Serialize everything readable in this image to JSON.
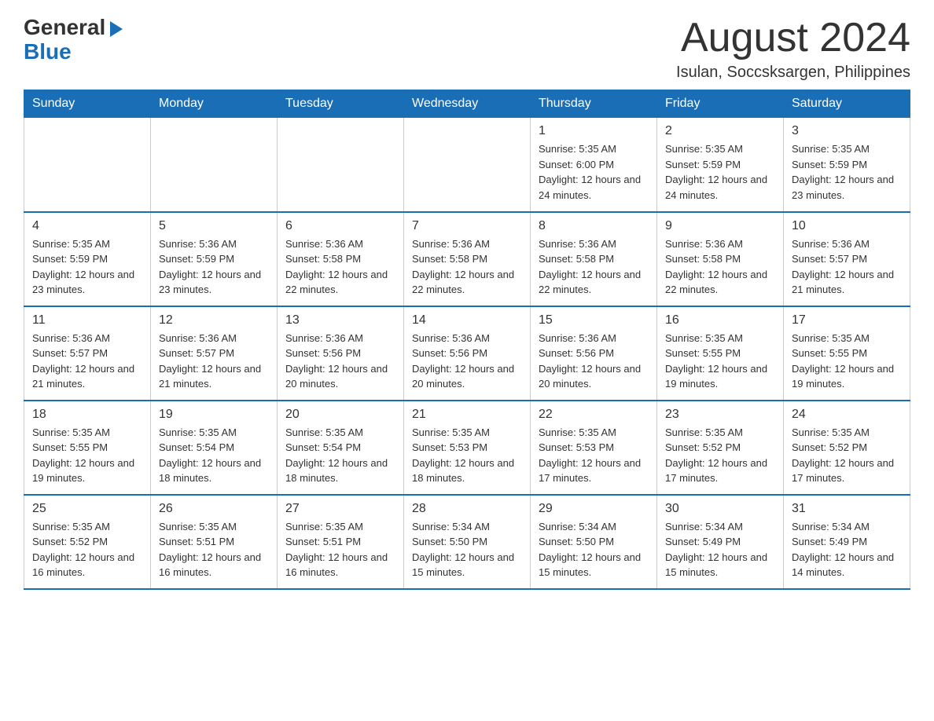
{
  "header": {
    "logo_general": "General",
    "logo_blue": "Blue",
    "month_title": "August 2024",
    "location": "Isulan, Soccsksargen, Philippines"
  },
  "days_of_week": [
    "Sunday",
    "Monday",
    "Tuesday",
    "Wednesday",
    "Thursday",
    "Friday",
    "Saturday"
  ],
  "weeks": [
    [
      {
        "day": "",
        "info": ""
      },
      {
        "day": "",
        "info": ""
      },
      {
        "day": "",
        "info": ""
      },
      {
        "day": "",
        "info": ""
      },
      {
        "day": "1",
        "info": "Sunrise: 5:35 AM\nSunset: 6:00 PM\nDaylight: 12 hours and 24 minutes."
      },
      {
        "day": "2",
        "info": "Sunrise: 5:35 AM\nSunset: 5:59 PM\nDaylight: 12 hours and 24 minutes."
      },
      {
        "day": "3",
        "info": "Sunrise: 5:35 AM\nSunset: 5:59 PM\nDaylight: 12 hours and 23 minutes."
      }
    ],
    [
      {
        "day": "4",
        "info": "Sunrise: 5:35 AM\nSunset: 5:59 PM\nDaylight: 12 hours and 23 minutes."
      },
      {
        "day": "5",
        "info": "Sunrise: 5:36 AM\nSunset: 5:59 PM\nDaylight: 12 hours and 23 minutes."
      },
      {
        "day": "6",
        "info": "Sunrise: 5:36 AM\nSunset: 5:58 PM\nDaylight: 12 hours and 22 minutes."
      },
      {
        "day": "7",
        "info": "Sunrise: 5:36 AM\nSunset: 5:58 PM\nDaylight: 12 hours and 22 minutes."
      },
      {
        "day": "8",
        "info": "Sunrise: 5:36 AM\nSunset: 5:58 PM\nDaylight: 12 hours and 22 minutes."
      },
      {
        "day": "9",
        "info": "Sunrise: 5:36 AM\nSunset: 5:58 PM\nDaylight: 12 hours and 22 minutes."
      },
      {
        "day": "10",
        "info": "Sunrise: 5:36 AM\nSunset: 5:57 PM\nDaylight: 12 hours and 21 minutes."
      }
    ],
    [
      {
        "day": "11",
        "info": "Sunrise: 5:36 AM\nSunset: 5:57 PM\nDaylight: 12 hours and 21 minutes."
      },
      {
        "day": "12",
        "info": "Sunrise: 5:36 AM\nSunset: 5:57 PM\nDaylight: 12 hours and 21 minutes."
      },
      {
        "day": "13",
        "info": "Sunrise: 5:36 AM\nSunset: 5:56 PM\nDaylight: 12 hours and 20 minutes."
      },
      {
        "day": "14",
        "info": "Sunrise: 5:36 AM\nSunset: 5:56 PM\nDaylight: 12 hours and 20 minutes."
      },
      {
        "day": "15",
        "info": "Sunrise: 5:36 AM\nSunset: 5:56 PM\nDaylight: 12 hours and 20 minutes."
      },
      {
        "day": "16",
        "info": "Sunrise: 5:35 AM\nSunset: 5:55 PM\nDaylight: 12 hours and 19 minutes."
      },
      {
        "day": "17",
        "info": "Sunrise: 5:35 AM\nSunset: 5:55 PM\nDaylight: 12 hours and 19 minutes."
      }
    ],
    [
      {
        "day": "18",
        "info": "Sunrise: 5:35 AM\nSunset: 5:55 PM\nDaylight: 12 hours and 19 minutes."
      },
      {
        "day": "19",
        "info": "Sunrise: 5:35 AM\nSunset: 5:54 PM\nDaylight: 12 hours and 18 minutes."
      },
      {
        "day": "20",
        "info": "Sunrise: 5:35 AM\nSunset: 5:54 PM\nDaylight: 12 hours and 18 minutes."
      },
      {
        "day": "21",
        "info": "Sunrise: 5:35 AM\nSunset: 5:53 PM\nDaylight: 12 hours and 18 minutes."
      },
      {
        "day": "22",
        "info": "Sunrise: 5:35 AM\nSunset: 5:53 PM\nDaylight: 12 hours and 17 minutes."
      },
      {
        "day": "23",
        "info": "Sunrise: 5:35 AM\nSunset: 5:52 PM\nDaylight: 12 hours and 17 minutes."
      },
      {
        "day": "24",
        "info": "Sunrise: 5:35 AM\nSunset: 5:52 PM\nDaylight: 12 hours and 17 minutes."
      }
    ],
    [
      {
        "day": "25",
        "info": "Sunrise: 5:35 AM\nSunset: 5:52 PM\nDaylight: 12 hours and 16 minutes."
      },
      {
        "day": "26",
        "info": "Sunrise: 5:35 AM\nSunset: 5:51 PM\nDaylight: 12 hours and 16 minutes."
      },
      {
        "day": "27",
        "info": "Sunrise: 5:35 AM\nSunset: 5:51 PM\nDaylight: 12 hours and 16 minutes."
      },
      {
        "day": "28",
        "info": "Sunrise: 5:34 AM\nSunset: 5:50 PM\nDaylight: 12 hours and 15 minutes."
      },
      {
        "day": "29",
        "info": "Sunrise: 5:34 AM\nSunset: 5:50 PM\nDaylight: 12 hours and 15 minutes."
      },
      {
        "day": "30",
        "info": "Sunrise: 5:34 AM\nSunset: 5:49 PM\nDaylight: 12 hours and 15 minutes."
      },
      {
        "day": "31",
        "info": "Sunrise: 5:34 AM\nSunset: 5:49 PM\nDaylight: 12 hours and 14 minutes."
      }
    ]
  ]
}
